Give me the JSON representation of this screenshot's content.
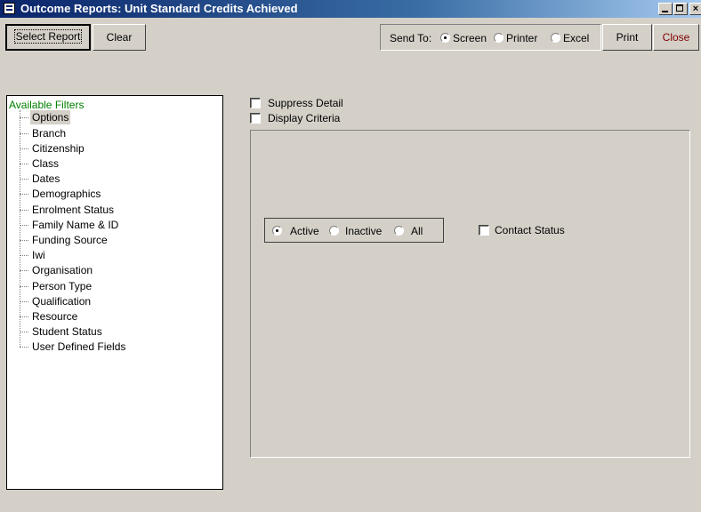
{
  "window": {
    "title": "Outcome Reports: Unit Standard Credits Achieved"
  },
  "toolbar": {
    "select_report": "Select Report",
    "clear": "Clear",
    "send_to_label": "Send To:",
    "send_to_options": [
      {
        "label": "Screen",
        "selected": true
      },
      {
        "label": "Printer",
        "selected": false
      },
      {
        "label": "Excel",
        "selected": false
      }
    ],
    "print": "Print",
    "close": "Close"
  },
  "filters": {
    "root": "Available Filters",
    "items": [
      "Options",
      "Branch",
      "Citizenship",
      "Class",
      "Dates",
      "Demographics",
      "Enrolment Status",
      "Family Name & ID",
      "Funding Source",
      "Iwi",
      "Organisation",
      "Person Type",
      "Qualification",
      "Resource",
      "Student Status",
      "User Defined Fields"
    ],
    "selected": "Options"
  },
  "options": {
    "suppress_detail": {
      "label": "Suppress Detail",
      "checked": false
    },
    "display_criteria": {
      "label": "Display Criteria",
      "checked": false
    },
    "status_options": [
      {
        "label": "Active",
        "selected": true
      },
      {
        "label": "Inactive",
        "selected": false
      },
      {
        "label": "All",
        "selected": false
      }
    ],
    "contact_status": {
      "label": "Contact Status",
      "checked": false
    }
  }
}
